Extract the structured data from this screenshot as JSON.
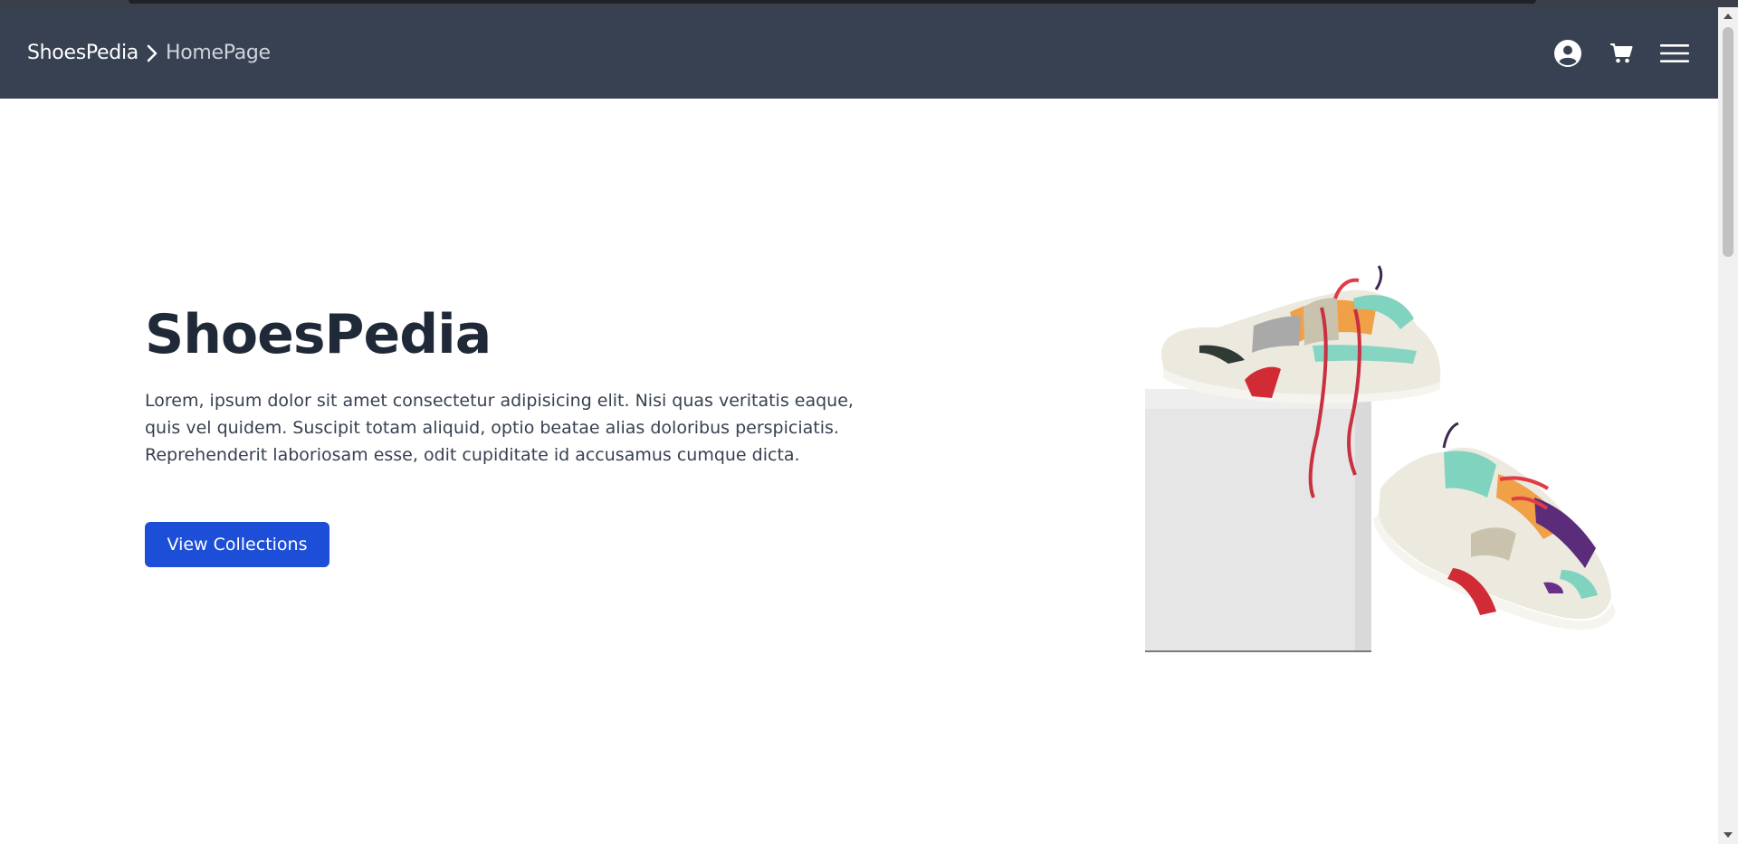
{
  "navbar": {
    "brand": "ShoesPedia",
    "current_page": "HomePage",
    "icons": [
      "account-circle-icon",
      "cart-icon",
      "hamburger-menu-icon"
    ],
    "background": "#374151"
  },
  "hero": {
    "title": "ShoesPedia",
    "description": "Lorem, ipsum dolor sit amet consectetur adipisicing elit. Nisi quas veritatis eaque, quis vel quidem. Suscipit totam aliquid, optio beatae alias doloribus perspiciatis. Reprehenderit laboriosam esse, odit cupiditate id accusamus cumque dicta.",
    "cta_label": "View Collections",
    "accent_color": "#1d4ed8"
  }
}
